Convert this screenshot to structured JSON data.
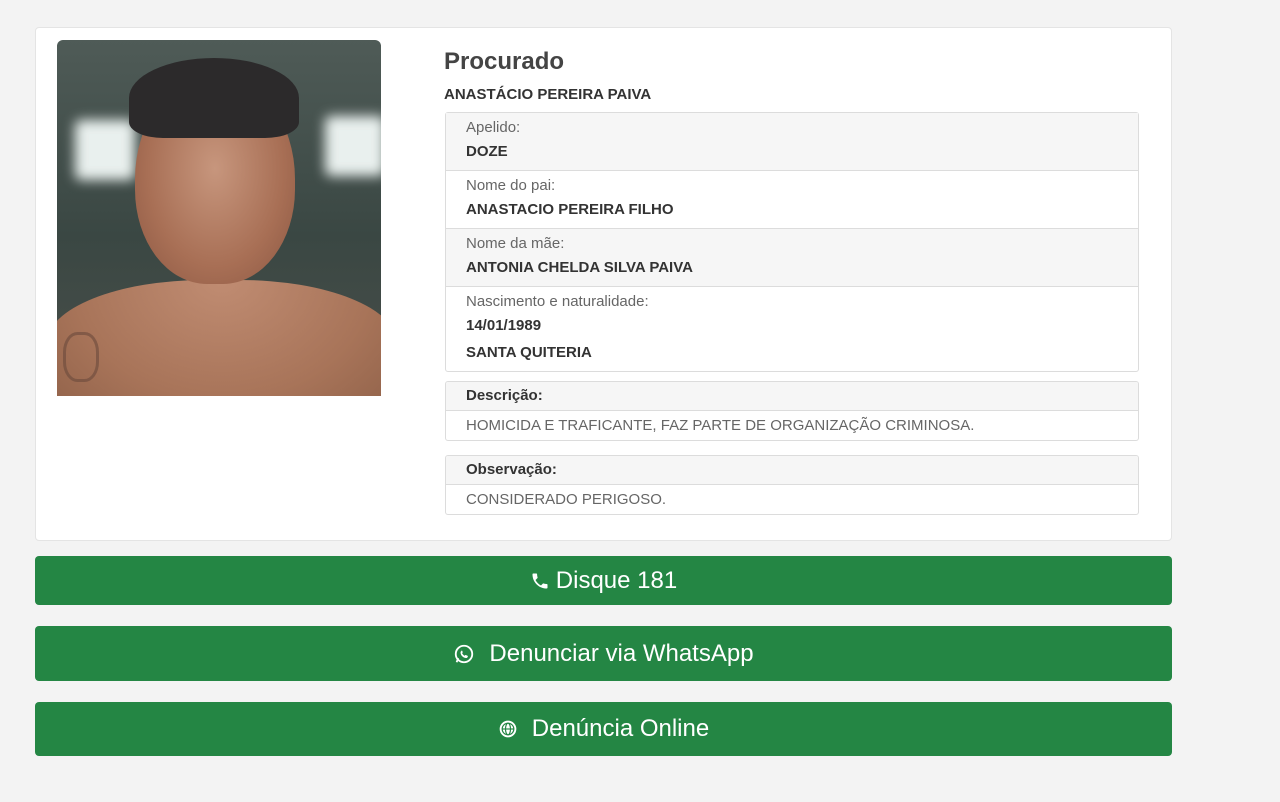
{
  "profile": {
    "status": "Procurado",
    "name": "ANASTÁCIO PEREIRA PAIVA",
    "photo_alt": "suspect-photo"
  },
  "details": {
    "nickname_label": "Apelido:",
    "nickname": "DOZE",
    "father_label": "Nome do pai:",
    "father": "ANASTACIO PEREIRA FILHO",
    "mother_label": "Nome da mãe:",
    "mother": "ANTONIA CHELDA SILVA PAIVA",
    "birth_label": "Nascimento e naturalidade:",
    "birth_date": "14/01/1989",
    "birth_place": "SANTA QUITERIA"
  },
  "description": {
    "label": "Descrição:",
    "text": "HOMICIDA E TRAFICANTE, FAZ PARTE DE ORGANIZAÇÃO CRIMINOSA."
  },
  "observation": {
    "label": "Observação:",
    "text": "CONSIDERADO PERIGOSO."
  },
  "actions": {
    "call": {
      "label": "Disque 181",
      "icon": "phone-icon"
    },
    "whatsapp": {
      "label": "Denunciar via WhatsApp",
      "icon": "whatsapp-icon"
    },
    "online": {
      "label": "Denúncia Online",
      "icon": "globe-icon"
    }
  },
  "colors": {
    "button": "#248644",
    "background": "#f3f3f3"
  }
}
